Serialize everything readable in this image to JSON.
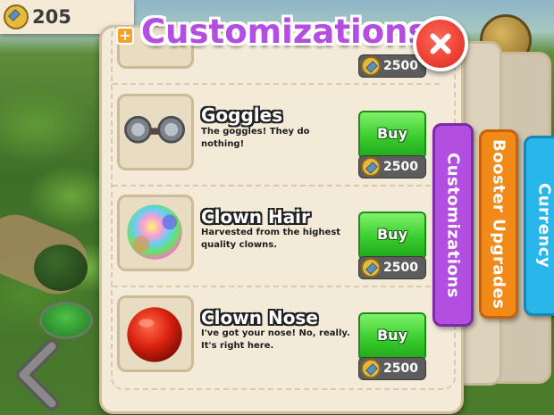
{
  "currency": {
    "coins": "205"
  },
  "header": {
    "title": "Customizations",
    "plus_label": "+"
  },
  "tabs": [
    {
      "label": "Customizations",
      "color": "#b24fe0"
    },
    {
      "label": "Booster Upgrades",
      "color": "#f28a1a"
    },
    {
      "label": "Currency",
      "color": "#29b6ea"
    }
  ],
  "items": [
    {
      "name": "",
      "price": "2500"
    },
    {
      "name": "Goggles",
      "description": "The goggles! They do nothing!",
      "buy_label": "Buy",
      "price": "2500",
      "icon": "goggles-icon"
    },
    {
      "name": "Clown Hair",
      "description": "Harvested from the highest quality clowns.",
      "buy_label": "Buy",
      "price": "2500",
      "icon": "clown-hair-icon"
    },
    {
      "name": "Clown Nose",
      "description": "I've got your nose! No, really. It's right here.",
      "buy_label": "Buy",
      "price": "2500",
      "icon": "clown-nose-icon"
    }
  ],
  "colors": {
    "buy_green": "#35c92a",
    "title_purple": "#b44de2",
    "close_red": "#e0241a"
  }
}
